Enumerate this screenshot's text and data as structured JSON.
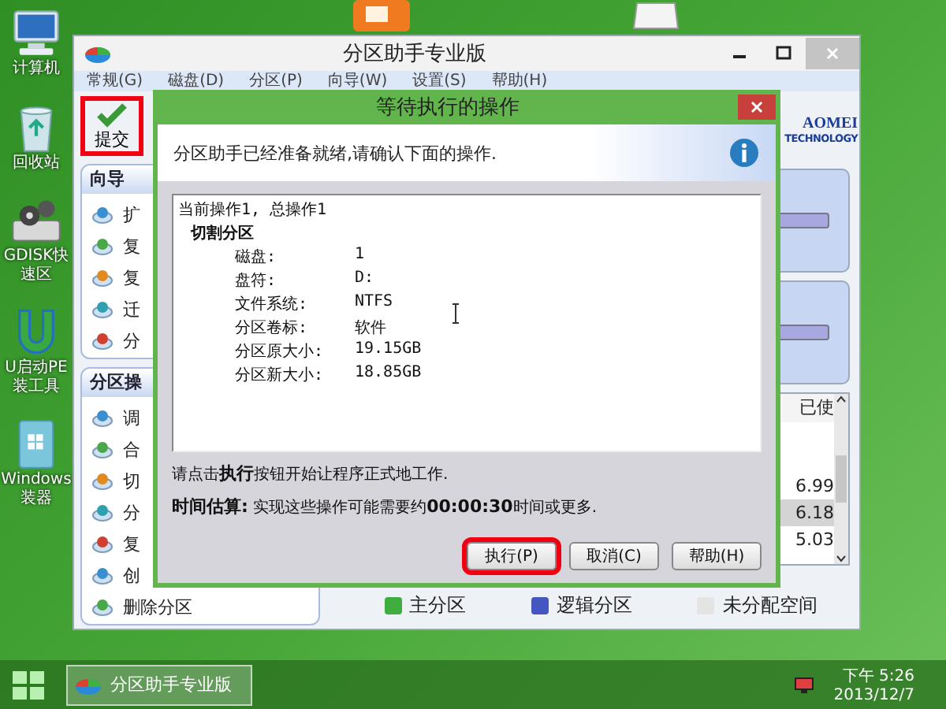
{
  "desktop_icons": [
    {
      "kind": "computer",
      "label": "计算机"
    },
    {
      "kind": "recycle",
      "label": "回收站"
    },
    {
      "kind": "gdisk",
      "label": "GDISK快速区"
    },
    {
      "kind": "u",
      "label": "U启动PE装工具"
    },
    {
      "kind": "windows",
      "label": "Windows装器"
    }
  ],
  "app_window": {
    "title": "分区助手专业版",
    "menu": [
      "常规(G)",
      "磁盘(D)",
      "分区(P)",
      "向导(W)",
      "设置(S)",
      "帮助(H)"
    ],
    "toolbar": {
      "label": "提交",
      "highlighted": true
    },
    "panels": [
      {
        "title": "向导",
        "items": [
          "扩",
          "复",
          "复",
          "迁",
          "分"
        ]
      },
      {
        "title": "分区操",
        "items": [
          "调",
          "合",
          "切",
          "分",
          "复",
          "创",
          "删除分区"
        ]
      }
    ],
    "logo": {
      "name": "AOMEI",
      "sub": "TECHNOLOGY"
    },
    "table": {
      "column_1": "已使",
      "rows": [
        {
          "value": "6.99",
          "selected": false
        },
        {
          "value": "6.18",
          "selected": true
        },
        {
          "value": "5.03",
          "selected": false
        }
      ]
    },
    "legend": [
      {
        "label": "主分区",
        "color": "#3fae3f"
      },
      {
        "label": "逻辑分区",
        "color": "#4656c0"
      },
      {
        "label": "未分配空间",
        "color": "#e4e4e4"
      }
    ]
  },
  "dialog": {
    "title": "等待执行的操作",
    "message": "分区助手已经准备就绪,请确认下面的操作.",
    "summary": "当前操作1, 总操作1",
    "operation": "切割分区",
    "fields": [
      {
        "label": "磁盘:",
        "value": "1"
      },
      {
        "label": "盘符:",
        "value": "D:"
      },
      {
        "label": "文件系统:",
        "value": "NTFS"
      },
      {
        "label": "分区卷标:",
        "value": "软件"
      },
      {
        "label": "分区原大小:",
        "value": "19.15GB"
      },
      {
        "label": "分区新大小:",
        "value": "18.85GB"
      }
    ],
    "notes": [
      "请点击**执行**按钮开始让程序正式地工作.",
      "**时间估算:** 实现这些操作可能需要约**00:00:30**时间或更多."
    ],
    "buttons": [
      {
        "label": "执行(P)",
        "highlighted": true
      },
      {
        "label": "取消(C)",
        "highlighted": false
      },
      {
        "label": "帮助(H)",
        "highlighted": false
      }
    ]
  },
  "taskbar": {
    "task": "分区助手专业版",
    "time": "下午 5:26",
    "date": "2013/12/7"
  }
}
